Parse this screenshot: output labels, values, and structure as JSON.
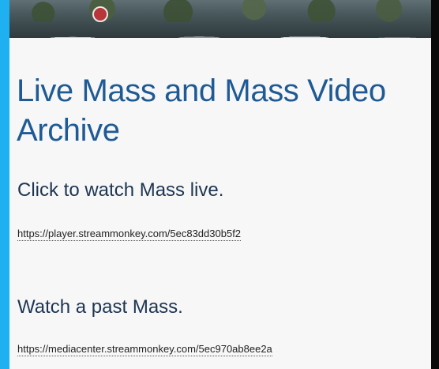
{
  "page": {
    "title": "Live Mass and Mass Video Archive"
  },
  "live": {
    "heading": "Click to watch Mass live.",
    "url": "https://player.streammonkey.com/5ec83dd30b5f2"
  },
  "past": {
    "heading": "Watch a past Mass.",
    "url": "https://mediacenter.streammonkey.com/5ec970ab8ee2a"
  },
  "colors": {
    "accent_bar": "#1eb0f0",
    "title": "#1f5a94",
    "heading": "#1d3552",
    "background": "#f7f7f7"
  }
}
